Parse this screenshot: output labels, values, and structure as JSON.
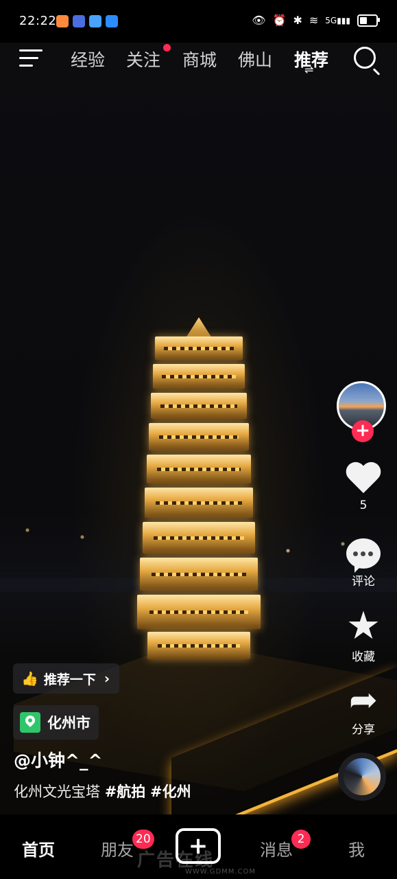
{
  "status_bar": {
    "time": "22:22",
    "network": "5G"
  },
  "top_nav": {
    "tabs": [
      {
        "label": "经验"
      },
      {
        "label": "关注",
        "has_dot": true
      },
      {
        "label": "商城"
      },
      {
        "label": "佛山"
      },
      {
        "label": "推荐",
        "active": true
      }
    ]
  },
  "right_rail": {
    "like_count": "5",
    "comment_label": "评论",
    "favorite_label": "收藏",
    "share_label": "分享"
  },
  "video_info": {
    "recommend_label": "推荐一下",
    "location": "化州市",
    "author": "@小钟^_^",
    "caption_text": "化州文光宝塔",
    "hashtags": [
      "#航拍",
      "#化州"
    ]
  },
  "bottom_tabs": {
    "home": "首页",
    "friends": "朋友",
    "friends_badge": "20",
    "messages": "消息",
    "messages_badge": "2",
    "me": "我"
  },
  "watermark": {
    "text": "广告在线",
    "url": "WWW.GDMM.COM"
  },
  "colors": {
    "accent_red": "#fe2c55",
    "location_green": "#2fc56b",
    "pagoda_gold": "#f4b43a"
  }
}
